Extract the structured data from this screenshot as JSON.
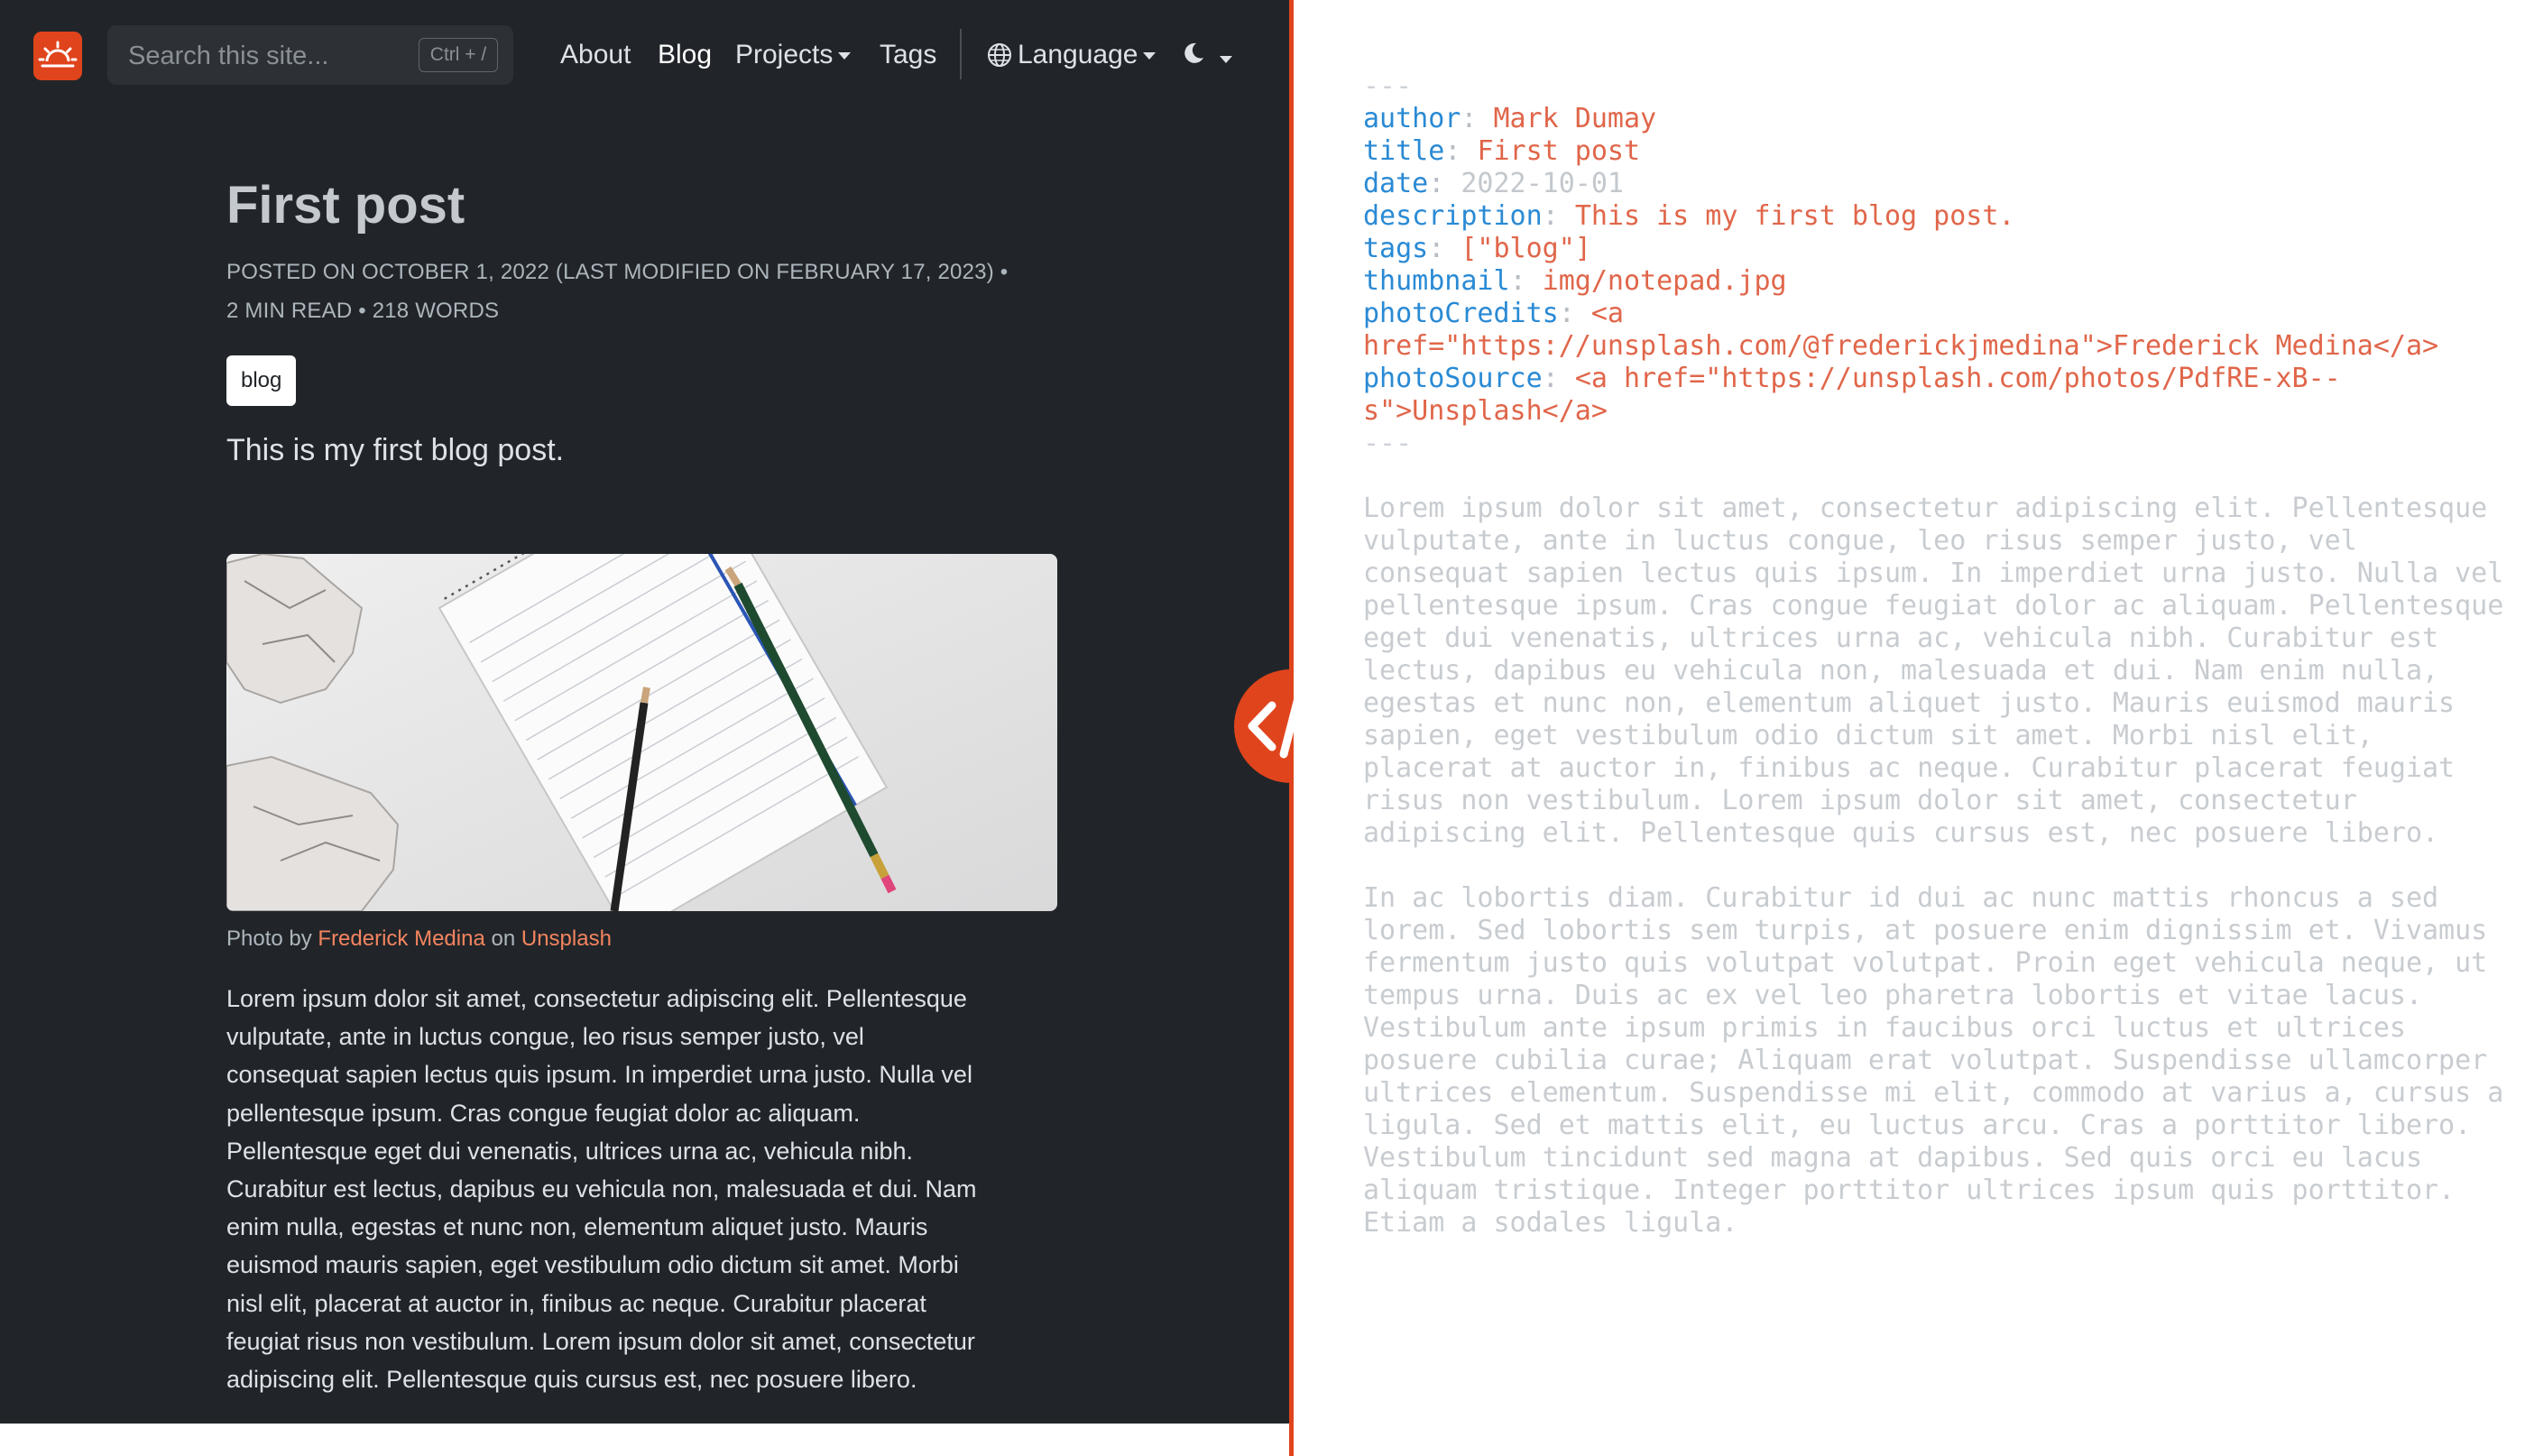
{
  "colors": {
    "accent": "#e0441c",
    "dark_bg": "#212529",
    "link": "#f4845f",
    "yaml_key": "#2a8ad4",
    "yaml_value": "#e0664a"
  },
  "navbar": {
    "logo_icon": "sunrise-icon",
    "search_placeholder": "Search this site...",
    "search_shortcut": "Ctrl + /",
    "items": [
      {
        "label": "About"
      },
      {
        "label": "Blog"
      },
      {
        "label": "Projects"
      },
      {
        "label": "Tags"
      }
    ],
    "active_item": "Blog",
    "language_label": "Language",
    "theme_icon": "moon-icon"
  },
  "post": {
    "title": "First post",
    "meta_line1": "POSTED ON OCTOBER 1, 2022 (LAST MODIFIED ON FEBRUARY 17, 2023) •",
    "meta_line2": "2 MIN READ • 218 WORDS",
    "tag": "blog",
    "lead": "This is my first blog post.",
    "image_alt": "notepad with pencils and crumpled paper",
    "caption": {
      "prefix": "Photo by",
      "author": "Frederick Medina",
      "middle": "on",
      "source": "Unsplash"
    },
    "body_lines": [
      "Lorem ipsum dolor sit amet, consectetur adipiscing elit. Pellentesque",
      "vulputate, ante in luctus congue, leo risus semper justo, vel",
      "consequat sapien lectus quis ipsum. In imperdiet urna justo. Nulla vel",
      "pellentesque ipsum. Cras congue feugiat dolor ac aliquam.",
      "Pellentesque eget dui venenatis, ultrices urna ac, vehicula nibh.",
      "Curabitur est lectus, dapibus eu vehicula non, malesuada et dui. Nam",
      "enim nulla, egestas et nunc non, elementum aliquet justo. Mauris",
      "euismod mauris sapien, eget vestibulum odio dictum sit amet. Morbi",
      "nisl elit, placerat at auctor in, finibus ac neque. Curabitur placerat",
      "feugiat risus non vestibulum. Lorem ipsum dolor sit amet, consectetur",
      "adipiscing elit. Pellentesque quis cursus est, nec posuere libero."
    ]
  },
  "divider_icon": "code-icon",
  "source": {
    "fence": "---",
    "front_matter": [
      {
        "key": "author",
        "value": "Mark Dumay"
      },
      {
        "key": "title",
        "value": "First post"
      },
      {
        "key": "date",
        "value": "2022-10-01"
      },
      {
        "key": "description",
        "value": "This is my first blog post."
      },
      {
        "key": "tags",
        "value": "[\"blog\"]"
      },
      {
        "key": "thumbnail",
        "value": "img/notepad.jpg"
      },
      {
        "key": "photoCredits",
        "value": "<a",
        "continuation": "href=\"https://unsplash.com/@frederickjmedina\">Frederick Medina</a>"
      },
      {
        "key": "photoSource",
        "value": "<a href=\"https://unsplash.com/photos/PdfRE-xB--",
        "continuation": "s\">Unsplash</a>"
      }
    ],
    "paragraph1": [
      "Lorem ipsum dolor sit amet, consectetur adipiscing elit. Pellentesque",
      "vulputate, ante in luctus congue, leo risus semper justo, vel",
      "consequat sapien lectus quis ipsum. In imperdiet urna justo. Nulla vel",
      "pellentesque ipsum. Cras congue feugiat dolor ac aliquam. Pellentesque",
      "eget dui venenatis, ultrices urna ac, vehicula nibh. Curabitur est",
      "lectus, dapibus eu vehicula non, malesuada et dui. Nam enim nulla,",
      "egestas et nunc non, elementum aliquet justo. Mauris euismod mauris",
      "sapien, eget vestibulum odio dictum sit amet. Morbi nisl elit,",
      "placerat at auctor in, finibus ac neque. Curabitur placerat feugiat",
      "risus non vestibulum. Lorem ipsum dolor sit amet, consectetur",
      "adipiscing elit. Pellentesque quis cursus est, nec posuere libero."
    ],
    "paragraph2": [
      "In ac lobortis diam. Curabitur id dui ac nunc mattis rhoncus a sed",
      "lorem. Sed lobortis sem turpis, at posuere enim dignissim et. Vivamus",
      "fermentum justo quis volutpat volutpat. Proin eget vehicula neque, ut",
      "tempus urna. Duis ac ex vel leo pharetra lobortis et vitae lacus.",
      "Vestibulum ante ipsum primis in faucibus orci luctus et ultrices",
      "posuere cubilia curae; Aliquam erat volutpat. Suspendisse ullamcorper",
      "ultrices elementum. Suspendisse mi elit, commodo at varius a, cursus a",
      "ligula. Sed et mattis elit, eu luctus arcu. Cras a porttitor libero.",
      "Vestibulum tincidunt sed magna at dapibus. Sed quis orci eu lacus",
      "aliquam tristique. Integer porttitor ultrices ipsum quis porttitor.",
      "Etiam a sodales ligula."
    ]
  }
}
